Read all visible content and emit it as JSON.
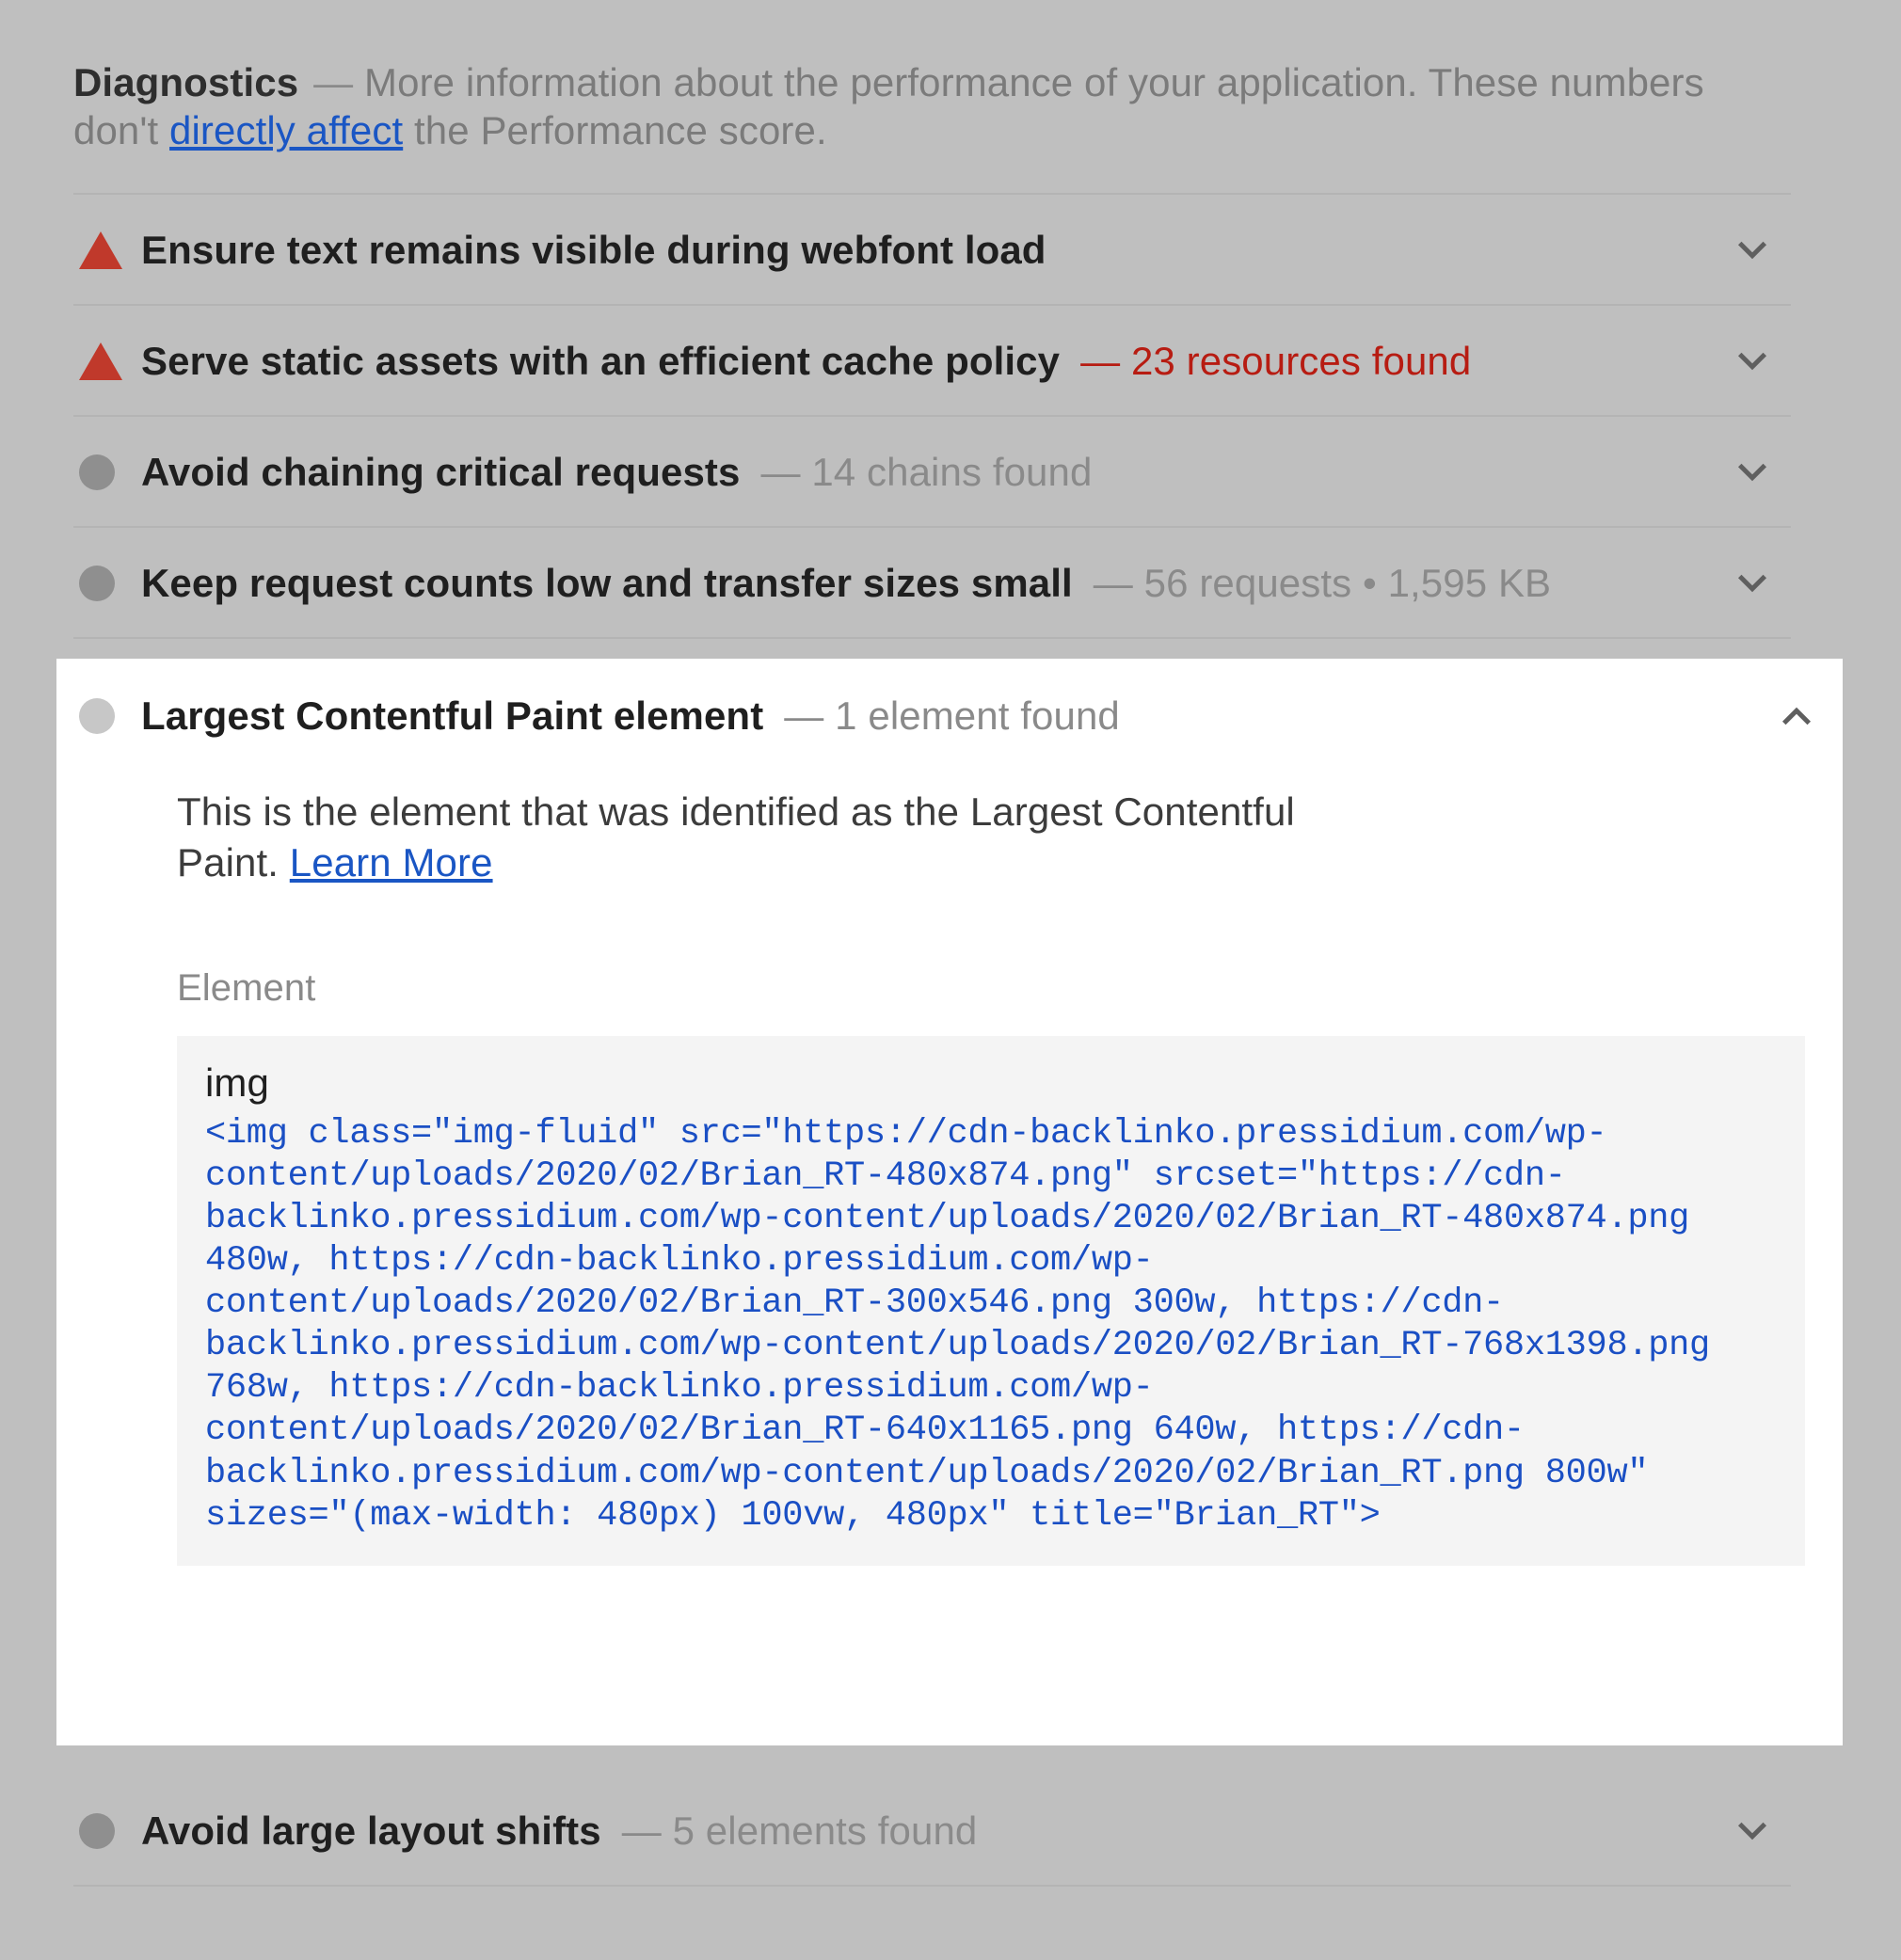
{
  "header": {
    "title": "Diagnostics",
    "dash": "—",
    "description_part1": "More information about the performance of your application. These numbers don't ",
    "link_text": "directly affect",
    "description_part2": " the Performance score."
  },
  "audits": [
    {
      "icon": "warning-triangle-icon",
      "title": "Ensure text remains visible during webfont load",
      "subtitle": "",
      "chevron": "chevron-down-icon"
    },
    {
      "icon": "warning-triangle-icon",
      "title": "Serve static assets with an efficient cache policy",
      "subtitle": "— 23 resources found",
      "chevron": "chevron-down-icon"
    },
    {
      "icon": "info-circle-icon",
      "title": "Avoid chaining critical requests",
      "subtitle": "— 14 chains found",
      "chevron": "chevron-down-icon"
    },
    {
      "icon": "info-circle-icon",
      "title": "Keep request counts low and transfer sizes small",
      "subtitle": "— 56 requests • 1,595 KB",
      "chevron": "chevron-down-icon"
    }
  ],
  "expanded_audit": {
    "icon": "info-circle-icon",
    "title": "Largest Contentful Paint element",
    "subtitle": "— 1 element found",
    "chevron": "chevron-up-icon",
    "description": "This is the element that was identified as the Largest Contentful Paint. ",
    "learn_more_label": "Learn More",
    "element_label": "Element",
    "code_tag": "img",
    "code_snippet": "<img class=\"img-fluid\" src=\"https://cdn-backlinko.pressidium.com/wp-content/uploads/2020/02/Brian_RT-480x874.png\" srcset=\"https://cdn-backlinko.pressidium.com/wp-content/uploads/2020/02/Brian_RT-480x874.png 480w, https://cdn-backlinko.pressidium.com/wp-content/uploads/2020/02/Brian_RT-300x546.png 300w, https://cdn-backlinko.pressidium.com/wp-content/uploads/2020/02/Brian_RT-768x1398.png 768w, https://cdn-backlinko.pressidium.com/wp-content/uploads/2020/02/Brian_RT-640x1165.png 640w, https://cdn-backlinko.pressidium.com/wp-content/uploads/2020/02/Brian_RT.png 800w\" sizes=\"(max-width: 480px) 100vw, 480px\" title=\"Brian_RT\">"
  },
  "bottom_audit": {
    "icon": "info-circle-icon",
    "title": "Avoid large layout shifts",
    "subtitle": "— 5 elements found",
    "chevron": "chevron-down-icon"
  },
  "colors": {
    "page_background": "#bfbfbf",
    "card_background": "#ffffff",
    "code_background": "#f4f4f4",
    "warning_red": "#c0392b",
    "error_text_red": "#b71c12",
    "link_blue": "#1a56c4",
    "code_blue": "#1a4fc4",
    "muted_gray": "#8a8a8a",
    "title_black": "#1f1f1f"
  }
}
